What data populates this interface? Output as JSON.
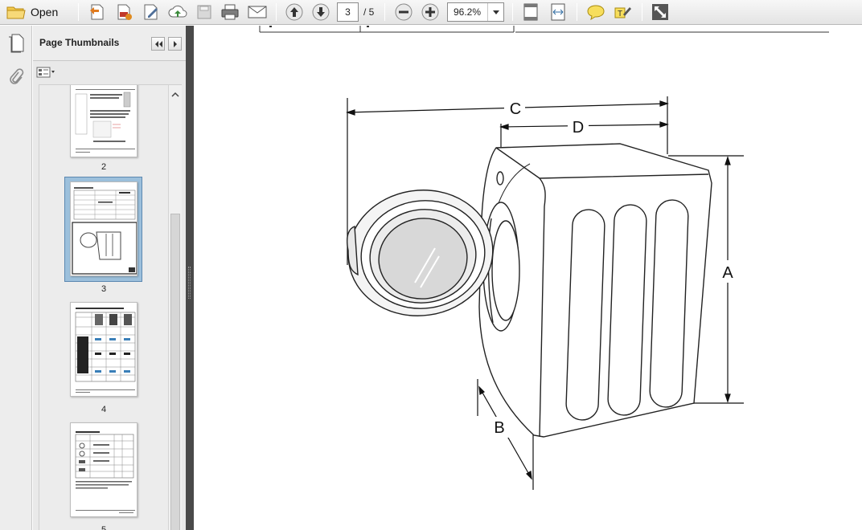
{
  "toolbar": {
    "open_label": "Open",
    "current_page": "3",
    "page_total": "/ 5",
    "zoom": "96.2%",
    "icons": [
      "folder-icon",
      "create-pdf-icon",
      "convert-icon",
      "edit-icon",
      "upload-icon",
      "save-icon",
      "print-icon",
      "email-icon",
      "previous-page-icon",
      "next-page-icon",
      "zoom-out-icon",
      "zoom-in-icon",
      "zoom-dropdown-icon",
      "fit-page-icon",
      "fit-width-icon",
      "comment-icon",
      "highlight-icon",
      "fullscreen-icon"
    ]
  },
  "panel": {
    "title": "Page Thumbnails",
    "thumbnails": [
      {
        "label": "2",
        "selected": false
      },
      {
        "label": "3",
        "selected": true
      },
      {
        "label": "4",
        "selected": false
      },
      {
        "label": "5",
        "selected": false
      }
    ]
  },
  "document": {
    "dimension_labels": {
      "a": "A",
      "b": "B",
      "c": "C",
      "d": "D"
    }
  },
  "colors": {
    "selection": "#9cc0dc",
    "splitter": "#4a4a4a",
    "toolbar_bg": "#ececec"
  }
}
